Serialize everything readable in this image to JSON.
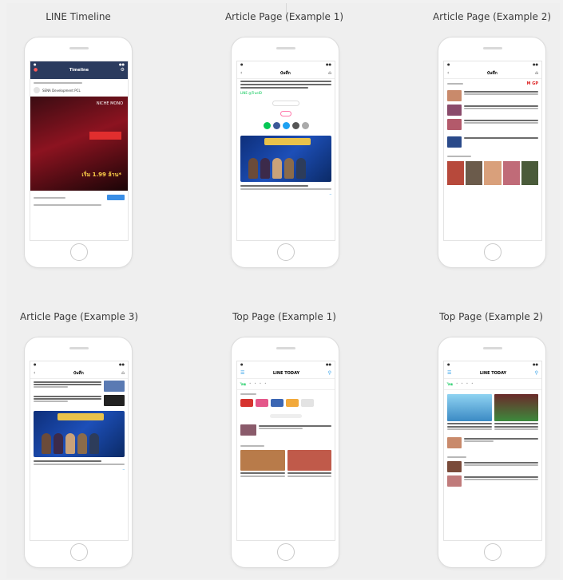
{
  "labels": {
    "line_timeline": "LINE Timeline",
    "article_1": "Article Page (Example 1)",
    "article_2": "Article Page (Example 2)",
    "article_3": "Article Page (Example 3)",
    "top_1": "Top Page (Example 1)",
    "top_2": "Top Page (Example 2)"
  },
  "timeline": {
    "nav_title": "Timeline",
    "sponsor": "SENA Development PCL",
    "promo_price": "เริ่ม 1.99 ล้าน*",
    "promo_brand": "NICHE MONO"
  },
  "article_nav_title": "บันทึก",
  "article_1": {
    "link_text": "LINE @TrueID"
  },
  "article_2": {
    "brand": "M GP"
  },
  "top": {
    "nav_title": "LINE TODAY",
    "tab_first": "ไทย"
  },
  "colors": {
    "line_green": "#06c755",
    "timeline_header": "#2b3b5e",
    "link_blue": "#2f9ee8"
  }
}
